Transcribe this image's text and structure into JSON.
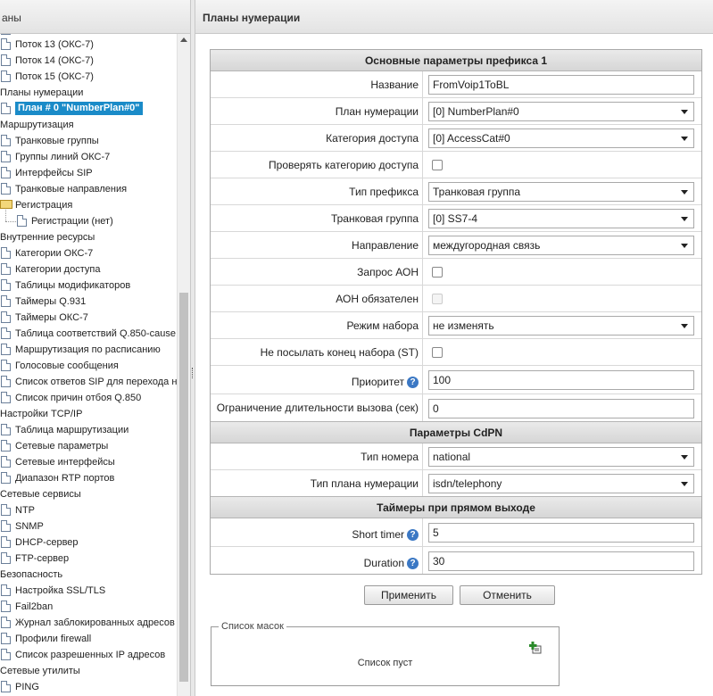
{
  "left": {
    "title": "аны",
    "items": [
      {
        "label": "Поток 13 (ОКС-7)",
        "kind": "doc",
        "level": 1
      },
      {
        "label": "Поток 14 (ОКС-7)",
        "kind": "doc",
        "level": 1
      },
      {
        "label": "Поток 15 (ОКС-7)",
        "kind": "doc",
        "level": 1
      },
      {
        "label": "Планы нумерации",
        "kind": "cat",
        "level": 0
      },
      {
        "label": "План # 0 \"NumberPlan#0\"",
        "kind": "doc",
        "level": 1,
        "selected": true
      },
      {
        "label": "Маршрутизация",
        "kind": "cat",
        "level": 0
      },
      {
        "label": "Транковые группы",
        "kind": "doc",
        "level": 1
      },
      {
        "label": "Группы линий ОКС-7",
        "kind": "doc",
        "level": 1
      },
      {
        "label": "Интерфейсы SIP",
        "kind": "doc",
        "level": 1
      },
      {
        "label": "Транковые направления",
        "kind": "doc",
        "level": 1
      },
      {
        "label": "Регистрация",
        "kind": "folder",
        "level": 1
      },
      {
        "label": "Регистрации (нет)",
        "kind": "doc",
        "level": 2
      },
      {
        "label": "Внутренние ресурсы",
        "kind": "cat",
        "level": 0
      },
      {
        "label": "Категории ОКС-7",
        "kind": "doc",
        "level": 1
      },
      {
        "label": "Категории доступа",
        "kind": "doc",
        "level": 1
      },
      {
        "label": "Таблицы модификаторов",
        "kind": "doc",
        "level": 1
      },
      {
        "label": "Таймеры Q.931",
        "kind": "doc",
        "level": 1
      },
      {
        "label": "Таймеры ОКС-7",
        "kind": "doc",
        "level": 1
      },
      {
        "label": "Таблица соответствий Q.850-cause",
        "kind": "doc",
        "level": 1
      },
      {
        "label": "Маршрутизация по расписанию",
        "kind": "doc",
        "level": 1
      },
      {
        "label": "Голосовые сообщения",
        "kind": "doc",
        "level": 1
      },
      {
        "label": "Список ответов SIP для перехода н",
        "kind": "doc",
        "level": 1
      },
      {
        "label": "Список причин отбоя Q.850",
        "kind": "doc",
        "level": 1
      },
      {
        "label": "Настройки TCP/IP",
        "kind": "cat",
        "level": 0
      },
      {
        "label": "Таблица маршрутизации",
        "kind": "doc",
        "level": 1
      },
      {
        "label": "Сетевые параметры",
        "kind": "doc",
        "level": 1
      },
      {
        "label": "Сетевые интерфейсы",
        "kind": "doc",
        "level": 1
      },
      {
        "label": "Диапазон RTP портов",
        "kind": "doc",
        "level": 1
      },
      {
        "label": "Сетевые сервисы",
        "kind": "cat",
        "level": 0
      },
      {
        "label": "NTP",
        "kind": "doc",
        "level": 1
      },
      {
        "label": "SNMP",
        "kind": "doc",
        "level": 1
      },
      {
        "label": "DHCP-сервер",
        "kind": "doc",
        "level": 1
      },
      {
        "label": "FTP-сервер",
        "kind": "doc",
        "level": 1
      },
      {
        "label": "Безопасность",
        "kind": "cat",
        "level": 0
      },
      {
        "label": "Настройка SSL/TLS",
        "kind": "doc",
        "level": 1
      },
      {
        "label": "Fail2ban",
        "kind": "doc",
        "level": 1
      },
      {
        "label": "Журнал заблокированных адресов",
        "kind": "doc",
        "level": 1
      },
      {
        "label": "Профили firewall",
        "kind": "doc",
        "level": 1
      },
      {
        "label": "Список разрешенных IP адресов",
        "kind": "doc",
        "level": 1
      },
      {
        "label": "Сетевые утилиты",
        "kind": "cat",
        "level": 0
      },
      {
        "label": "PING",
        "kind": "doc",
        "level": 1
      }
    ]
  },
  "right": {
    "title": "Планы нумерации",
    "section_main": "Основные параметры префикса 1",
    "section_cdpn": "Параметры CdPN",
    "section_timers": "Таймеры при прямом выходе",
    "fields": {
      "name": {
        "label": "Название",
        "value": "FromVoip1ToBL"
      },
      "plan": {
        "label": "План нумерации",
        "value": "[0] NumberPlan#0"
      },
      "access_cat": {
        "label": "Категория доступа",
        "value": "[0] AccessCat#0"
      },
      "check_access": {
        "label": "Проверять категорию доступа",
        "checked": false
      },
      "prefix_type": {
        "label": "Тип префикса",
        "value": "Транковая группа"
      },
      "trunk_group": {
        "label": "Транковая группа",
        "value": "[0] SS7-4"
      },
      "direction": {
        "label": "Направление",
        "value": "междугородная связь"
      },
      "aon_request": {
        "label": "Запрос АОН",
        "checked": false
      },
      "aon_required": {
        "label": "АОН обязателен",
        "checked": false,
        "disabled": true
      },
      "dial_mode": {
        "label": "Режим набора",
        "value": "не изменять"
      },
      "no_st": {
        "label": "Не посылать конец набора (ST)",
        "checked": false
      },
      "priority": {
        "label": "Приоритет",
        "value": "100"
      },
      "duration_limit": {
        "label": "Ограничение длительности вызова (сек)",
        "value": "0"
      },
      "number_type": {
        "label": "Тип номера",
        "value": "national"
      },
      "numbering_plan_type": {
        "label": "Тип плана нумерации",
        "value": "isdn/telephony"
      },
      "short_timer": {
        "label": "Short timer",
        "value": "5"
      },
      "duration": {
        "label": "Duration",
        "value": "30"
      }
    },
    "help_glyph": "?",
    "buttons": {
      "apply": "Применить",
      "cancel": "Отменить"
    },
    "masks": {
      "legend": "Список масок",
      "empty": "Список пуст"
    }
  }
}
